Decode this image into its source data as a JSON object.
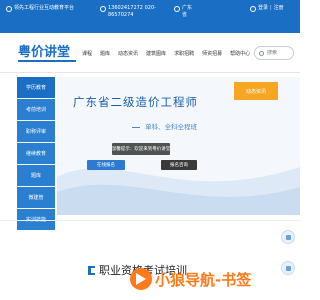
{
  "topbar": {
    "slogan": "领先工程行业互动教育平台",
    "phone": "13602417272 020-86570274",
    "address": "广东省",
    "login": "登录",
    "separator": "|",
    "register": "注册"
  },
  "brand": {
    "logo_text": "粤价讲堂"
  },
  "nav": {
    "items": [
      "课程",
      "题库",
      "动态资讯",
      "建筑图库",
      "求职招聘",
      "师资招募",
      "帮助中心"
    ],
    "search_placeholder": "搜索"
  },
  "sidebar": {
    "items": [
      "学历教育",
      "考前培训",
      "职称评审",
      "继续教育",
      "题库",
      "微建管",
      "实训技能"
    ]
  },
  "banner": {
    "title": "广东省二级造价工程师",
    "subtitle": "单科、全科全程班",
    "button_primary": "在线报名",
    "button_secondary": "报名咨询",
    "side_button": "动态资讯"
  },
  "toast": {
    "text": "温馨提示：欢迎来到粤价讲堂"
  },
  "section": {
    "title": "职业资格考试培训"
  },
  "watermark": {
    "brand_cn": "小狼导航",
    "brand_en": "-书签"
  },
  "colors": {
    "primary": "#1a6fc4",
    "accent": "#f5a623",
    "watermark": "#ff7a1a"
  }
}
